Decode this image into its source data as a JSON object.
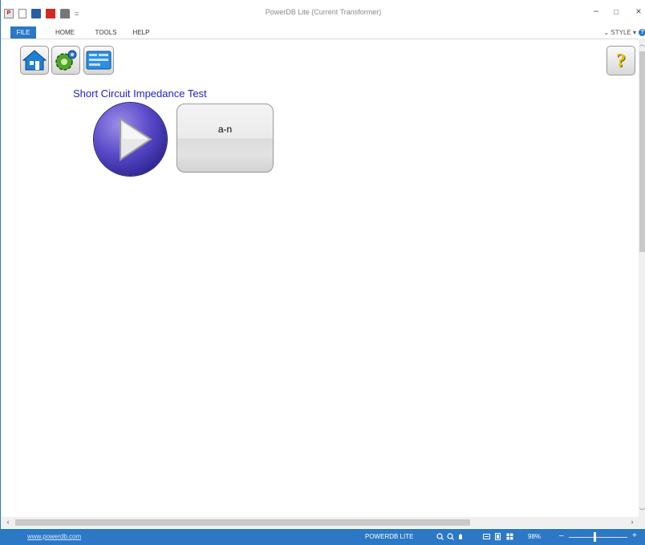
{
  "window": {
    "title": "PowerDB Lite (Current Transformer)",
    "controls": {
      "minimize": "–",
      "maximize": "□",
      "close": "×"
    }
  },
  "quick_access": {
    "logo_text": "PDB LITE",
    "more": "="
  },
  "ribbon": {
    "tabs": [
      "FILE",
      "HOME",
      "TOOLS",
      "HELP"
    ],
    "style_menu": "STYLE",
    "help_badge": "?"
  },
  "toolbar": {
    "icons": [
      "home-icon",
      "settings-icon",
      "form-icon"
    ],
    "help_label": "?"
  },
  "test": {
    "title": "Short Circuit Impedance Test",
    "phase_button": "a-n"
  },
  "status_bar": {
    "link": "www.powerdb.com",
    "product": "POWERDB LITE",
    "zoom_percent": "98%",
    "zoom_minus": "–",
    "zoom_plus": "+",
    "zoom_level": 0.45
  },
  "colors": {
    "accent": "#2b78c5",
    "test_title": "#1f1fd0",
    "help_icon": "#e8c400"
  }
}
